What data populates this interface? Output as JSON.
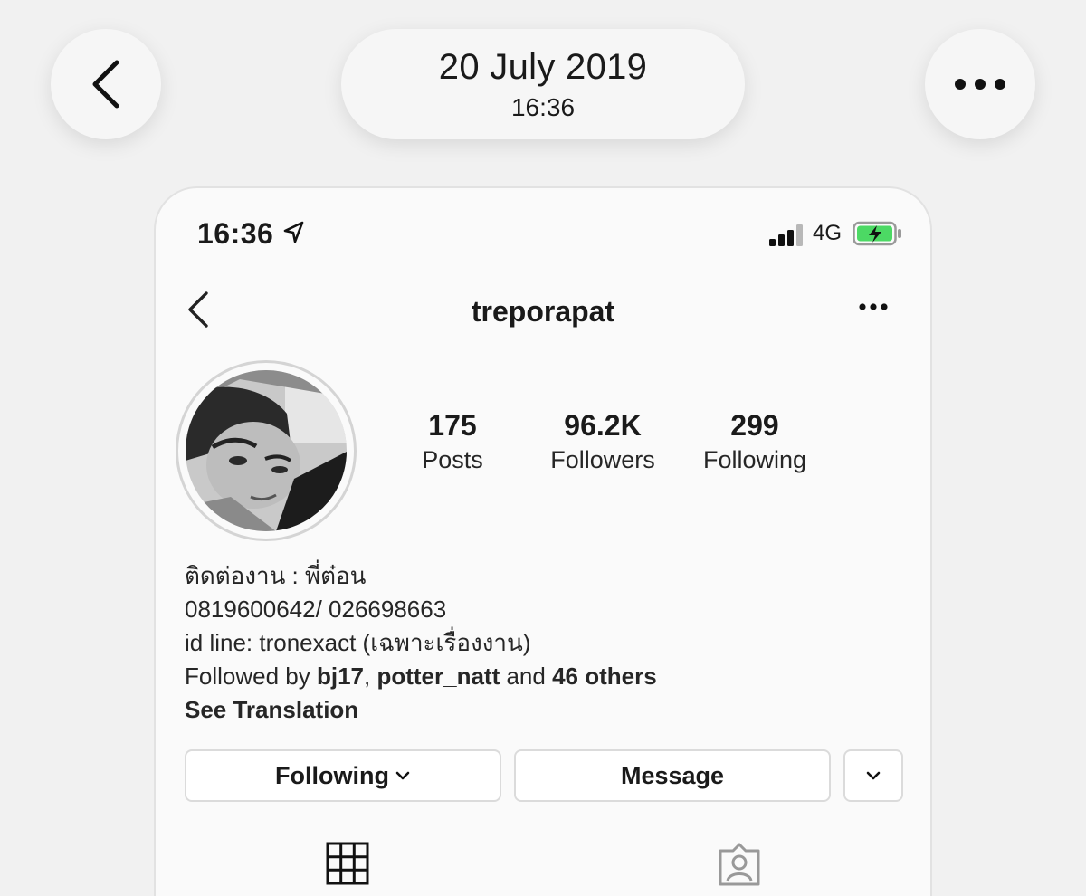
{
  "viewer": {
    "date": "20 July 2019",
    "time": "16:36",
    "icons": {
      "back": "chevron-left-icon",
      "more": "more-horizontal-icon"
    }
  },
  "phone": {
    "status_bar": {
      "time": "16:36",
      "network": "4G",
      "icons": [
        "location-arrow-icon",
        "signal-bars-icon",
        "battery-charging-icon"
      ],
      "battery_color": "#4cd964"
    },
    "nav": {
      "title": "treporapat"
    },
    "profile": {
      "stats": [
        {
          "value": "175",
          "label": "Posts"
        },
        {
          "value": "96.2K",
          "label": "Followers"
        },
        {
          "value": "299",
          "label": "Following"
        }
      ],
      "bio": {
        "line1": "ติดต่องาน : พี่ต๋อน",
        "line2": "0819600642/ 026698663",
        "line3": "id line: tronexact (เฉพาะเรื่องงาน)",
        "followed_prefix": "Followed by ",
        "followed_user1": "bj17",
        "followed_sep": ", ",
        "followed_user2": "potter_natt",
        "followed_and": " and ",
        "followed_others": "46 others",
        "see_translation": "See Translation"
      },
      "buttons": {
        "following": "Following",
        "message": "Message"
      },
      "tabs": [
        "grid-icon",
        "tagged-person-icon"
      ]
    }
  }
}
